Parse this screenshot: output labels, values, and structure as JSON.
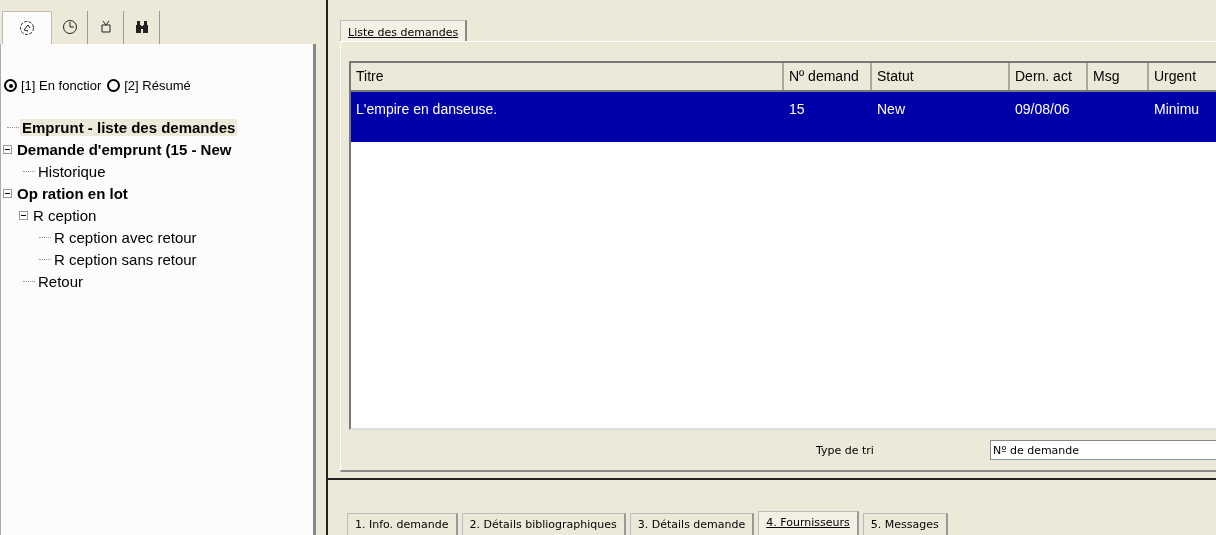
{
  "left_panel": {
    "icon_tabs": [
      {
        "selected": true
      },
      {
        "selected": false
      },
      {
        "selected": false
      },
      {
        "selected": false
      }
    ],
    "mode_radios": [
      {
        "label": "[1] En fonctior",
        "selected": true
      },
      {
        "label": "[2] Résumé",
        "selected": false
      }
    ],
    "tree": [
      {
        "label": "Emprunt - liste des demandes",
        "bold": true,
        "selected": true
      },
      {
        "label": "Demande d'emprunt (15 - New",
        "bold": true,
        "selected": false,
        "expanded": true,
        "children": [
          {
            "label": "Historique",
            "bold": false,
            "selected": false
          }
        ]
      },
      {
        "label": "Op ration en lot",
        "bold": true,
        "selected": false,
        "expanded": true,
        "children": [
          {
            "label": "R ception",
            "bold": false,
            "selected": false,
            "expanded": true,
            "children": [
              {
                "label": "R ception avec retour",
                "bold": false,
                "selected": false
              },
              {
                "label": "R ception sans retour",
                "bold": false,
                "selected": false
              }
            ]
          },
          {
            "label": "Retour",
            "bold": false,
            "selected": false
          }
        ]
      }
    ]
  },
  "main_tabs": [
    {
      "label": "Liste des demandes",
      "selected": true
    }
  ],
  "table": {
    "columns": [
      "Titre",
      "Nº demand",
      "Statut",
      "Dern. act",
      "Msg",
      "Urgent"
    ],
    "rows": [
      {
        "selected": true,
        "cells": [
          "L'empire en danseuse.",
          "15",
          "New",
          "09/08/06",
          "",
          "Minimu"
        ]
      }
    ]
  },
  "sort": {
    "label": "Type de tri",
    "value": "Nº de demande"
  },
  "bottom_tabs": [
    {
      "label": "1. Info. demande",
      "selected": false
    },
    {
      "label": "2. Détails bibliographiques",
      "selected": false
    },
    {
      "label": "3. Détails demande",
      "selected": false
    },
    {
      "label": "4. Fournisseurs",
      "selected": true
    },
    {
      "label": "5. Messages",
      "selected": false
    }
  ]
}
